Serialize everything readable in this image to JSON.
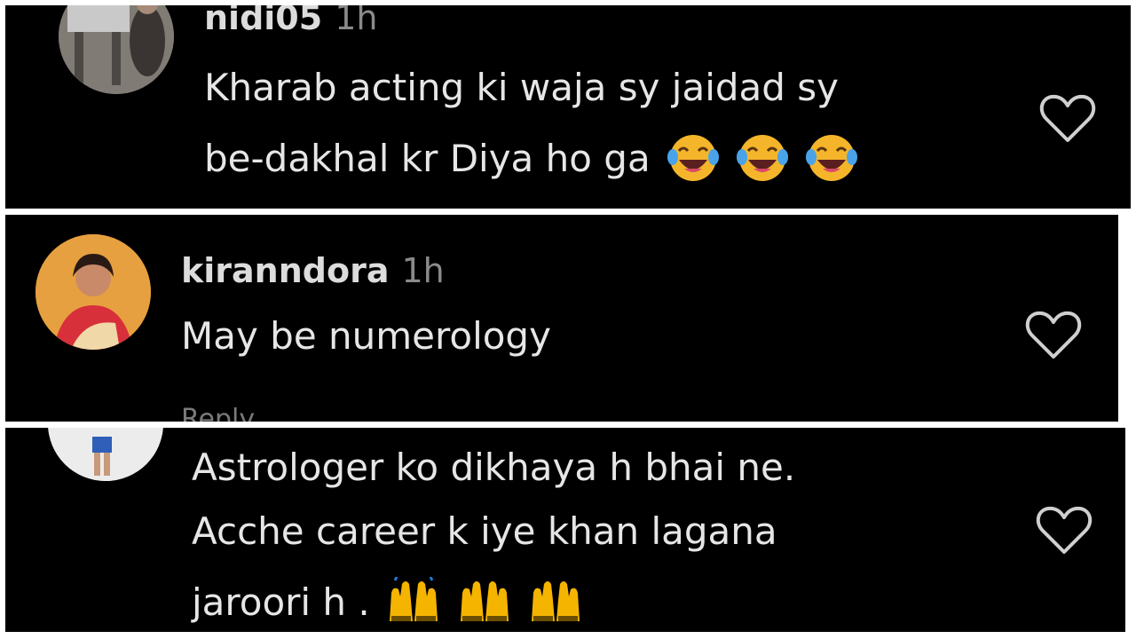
{
  "comments": [
    {
      "username": "nidi05",
      "time": "1h",
      "lines": [
        "Kharab acting ki waja sy jaidad sy",
        "be-dakhal kr Diya ho ga"
      ],
      "emoji": "face-with-tears-of-joy",
      "emoji_count": 3
    },
    {
      "username": "kiranndora",
      "time": "1h",
      "lines": [
        "May be numerology"
      ],
      "reply_peek": "Reply"
    },
    {
      "lines": [
        "Astrologer ko dikhaya h bhai ne.",
        "Acche career k iye khan lagana",
        "jaroori h ."
      ],
      "emoji": "raising-hands",
      "emoji_count": 3
    }
  ],
  "icons": {
    "like": "heart-outline-icon"
  },
  "colors": {
    "panel": "#000000",
    "text": "#e6e6e6",
    "muted": "#8a8a8a",
    "divider": "#ffffff"
  }
}
